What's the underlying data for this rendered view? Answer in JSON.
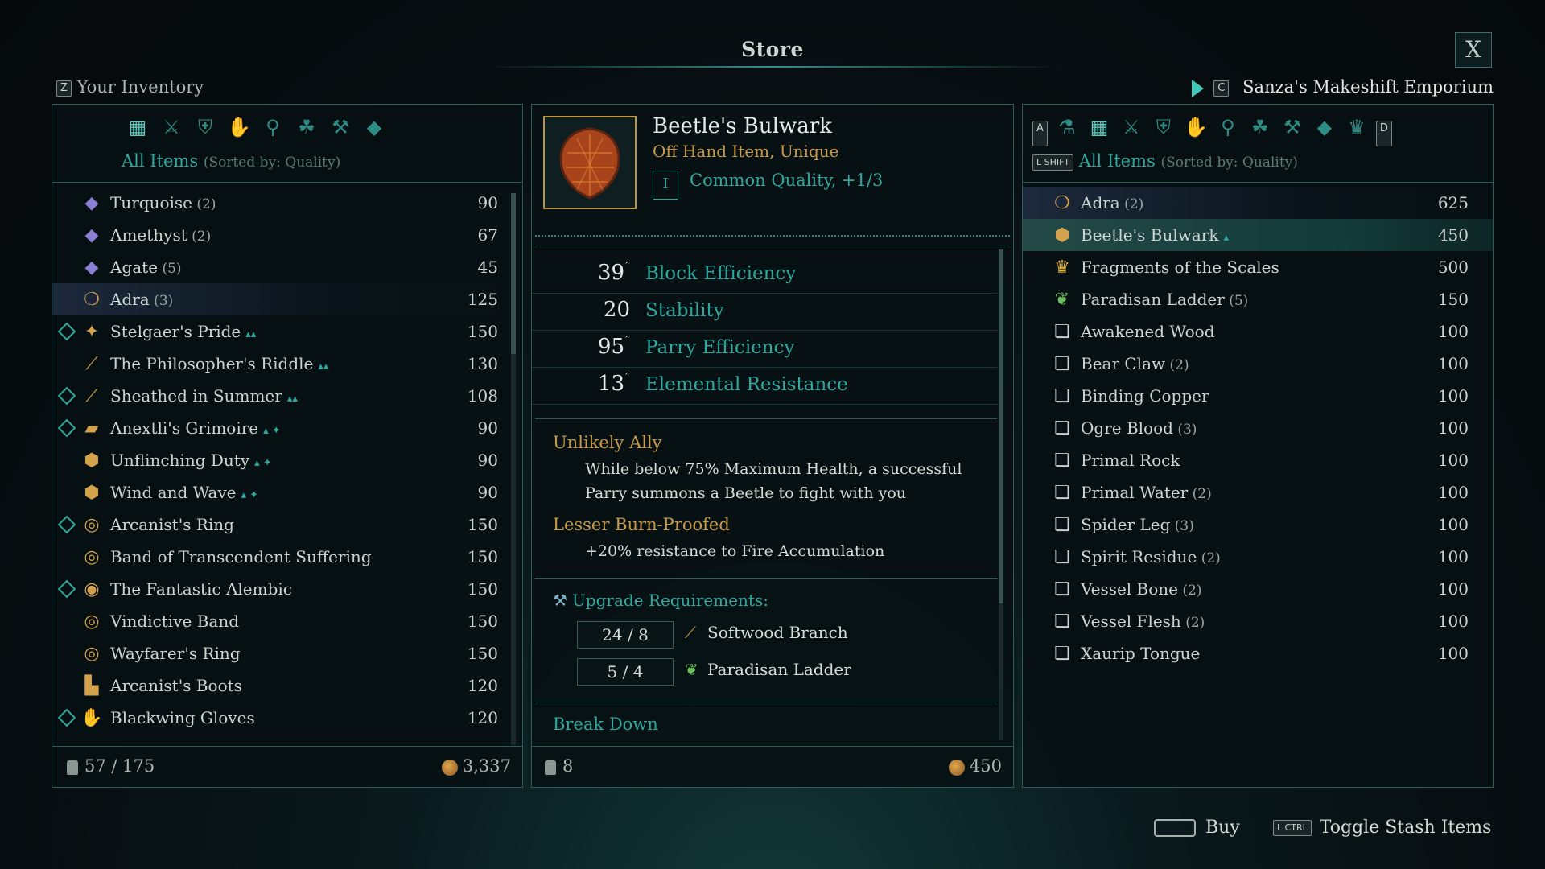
{
  "window": {
    "title": "Store",
    "close_label": "X"
  },
  "inventory": {
    "key": "Z",
    "title": "Your Inventory",
    "filter_label": "All Items",
    "sort_label": "(Sorted by: Quality)",
    "category_icons": [
      "all-items-icon",
      "weapons-icon",
      "armor-icon",
      "gloves-icon",
      "accessories-icon",
      "consumables-icon",
      "crafting-icon",
      "gems-icon"
    ],
    "items": [
      {
        "name": "Turquoise",
        "qty": "(2)",
        "price": "90",
        "icon": "gem-icon",
        "upgradeable": false,
        "tags": ""
      },
      {
        "name": "Amethyst",
        "qty": "(2)",
        "price": "67",
        "icon": "gem-icon",
        "upgradeable": false,
        "tags": ""
      },
      {
        "name": "Agate",
        "qty": "(5)",
        "price": "45",
        "icon": "gem-icon",
        "upgradeable": false,
        "tags": ""
      },
      {
        "name": "Adra",
        "qty": "(3)",
        "price": "125",
        "icon": "adra-icon",
        "upgradeable": false,
        "tags": "",
        "highlight": true
      },
      {
        "name": "Stelgaer's Pride",
        "qty": "",
        "price": "150",
        "icon": "armor-icon",
        "upgradeable": true,
        "tags": "▴▴"
      },
      {
        "name": "The Philosopher's Riddle",
        "qty": "",
        "price": "130",
        "icon": "sword-icon",
        "upgradeable": false,
        "tags": "▴▴"
      },
      {
        "name": "Sheathed in Summer",
        "qty": "",
        "price": "108",
        "icon": "dagger-icon",
        "upgradeable": true,
        "tags": "▴▴"
      },
      {
        "name": "Anextli's Grimoire",
        "qty": "",
        "price": "90",
        "icon": "grimoire-icon",
        "upgradeable": true,
        "tags": "▴ ✦"
      },
      {
        "name": "Unflinching Duty",
        "qty": "",
        "price": "90",
        "icon": "shield-icon",
        "upgradeable": false,
        "tags": "▴ ✦"
      },
      {
        "name": "Wind and Wave",
        "qty": "",
        "price": "90",
        "icon": "shield-icon",
        "upgradeable": false,
        "tags": "▴ ✦"
      },
      {
        "name": "Arcanist's Ring",
        "qty": "",
        "price": "150",
        "icon": "ring-icon",
        "upgradeable": true,
        "tags": ""
      },
      {
        "name": "Band of Transcendent Suffering",
        "qty": "",
        "price": "150",
        "icon": "ring-icon",
        "upgradeable": false,
        "tags": ""
      },
      {
        "name": "The Fantastic Alembic",
        "qty": "",
        "price": "150",
        "icon": "amulet-icon",
        "upgradeable": true,
        "tags": ""
      },
      {
        "name": "Vindictive Band",
        "qty": "",
        "price": "150",
        "icon": "ring-icon",
        "upgradeable": false,
        "tags": ""
      },
      {
        "name": "Wayfarer's Ring",
        "qty": "",
        "price": "150",
        "icon": "ring-icon",
        "upgradeable": false,
        "tags": ""
      },
      {
        "name": "Arcanist's Boots",
        "qty": "",
        "price": "120",
        "icon": "boots-icon",
        "upgradeable": false,
        "tags": ""
      },
      {
        "name": "Blackwing Gloves",
        "qty": "",
        "price": "120",
        "icon": "gloves-icon",
        "upgradeable": true,
        "tags": ""
      }
    ],
    "capacity": "57 / 175",
    "currency": "3,337"
  },
  "detail": {
    "name": "Beetle's Bulwark",
    "type": "Off Hand Item, Unique",
    "quality_tier": "I",
    "quality_text": "Common Quality, +1/3",
    "stats": [
      {
        "value": "39",
        "label": "Block Efficiency",
        "upgradeable": true
      },
      {
        "value": "20",
        "label": "Stability",
        "upgradeable": false
      },
      {
        "value": "95",
        "label": "Parry Efficiency",
        "upgradeable": true
      },
      {
        "value": "13",
        "label": "Elemental Resistance",
        "upgradeable": true
      }
    ],
    "traits": [
      {
        "title": "Unlikely Ally",
        "lines": [
          "While below 75% Maximum Health, a successful",
          "Parry summons a Beetle to fight with you"
        ]
      },
      {
        "title": "Lesser Burn-Proofed",
        "lines": [
          "+20% resistance to Fire Accumulation"
        ]
      }
    ],
    "upgrade_title": "Upgrade Requirements:",
    "requirements": [
      {
        "count": "24 / 8",
        "name": "Softwood Branch"
      },
      {
        "count": "5 / 4",
        "name": "Paradisan Ladder"
      }
    ],
    "break_down_title": "Break Down",
    "weight": "8",
    "price": "450"
  },
  "vendor": {
    "key": "C",
    "title": "Sanza's Makeshift Emporium",
    "tab_prev_key": "A",
    "tab_next_key": "D",
    "filter_key": "L SHIFT",
    "filter_label": "All Items",
    "sort_label": "(Sorted by: Quality)",
    "category_icons": [
      "potions-icon",
      "all-items-icon",
      "weapons-icon",
      "armor-icon",
      "gloves-icon",
      "accessories-icon",
      "consumables-icon",
      "crafting-icon",
      "gems-icon",
      "crown-icon"
    ],
    "items": [
      {
        "name": "Adra",
        "qty": "(2)",
        "price": "625",
        "icon": "adra-icon",
        "tags": "",
        "highlight": "dim"
      },
      {
        "name": "Beetle's Bulwark",
        "qty": "",
        "price": "450",
        "icon": "shield-icon",
        "tags": "▴",
        "highlight": "bright"
      },
      {
        "name": "Fragments of the Scales",
        "qty": "",
        "price": "500",
        "icon": "crown-icon",
        "tags": ""
      },
      {
        "name": "Paradisan Ladder",
        "qty": "(5)",
        "price": "150",
        "icon": "herb-icon",
        "tags": ""
      },
      {
        "name": "Awakened Wood",
        "qty": "",
        "price": "100",
        "icon": "scroll-icon",
        "tags": ""
      },
      {
        "name": "Bear Claw",
        "qty": "(2)",
        "price": "100",
        "icon": "scroll-icon",
        "tags": ""
      },
      {
        "name": "Binding Copper",
        "qty": "",
        "price": "100",
        "icon": "scroll-icon",
        "tags": ""
      },
      {
        "name": "Ogre Blood",
        "qty": "(3)",
        "price": "100",
        "icon": "scroll-icon",
        "tags": ""
      },
      {
        "name": "Primal Rock",
        "qty": "",
        "price": "100",
        "icon": "scroll-icon",
        "tags": ""
      },
      {
        "name": "Primal Water",
        "qty": "(2)",
        "price": "100",
        "icon": "scroll-icon",
        "tags": ""
      },
      {
        "name": "Spider Leg",
        "qty": "(3)",
        "price": "100",
        "icon": "scroll-icon",
        "tags": ""
      },
      {
        "name": "Spirit Residue",
        "qty": "(2)",
        "price": "100",
        "icon": "scroll-icon",
        "tags": ""
      },
      {
        "name": "Vessel Bone",
        "qty": "(2)",
        "price": "100",
        "icon": "scroll-icon",
        "tags": ""
      },
      {
        "name": "Vessel Flesh",
        "qty": "(2)",
        "price": "100",
        "icon": "scroll-icon",
        "tags": ""
      },
      {
        "name": "Xaurip Tongue",
        "qty": "",
        "price": "100",
        "icon": "scroll-icon",
        "tags": ""
      }
    ]
  },
  "actions": {
    "buy_label": "Buy",
    "toggle_key": "L CTRL",
    "toggle_label": "Toggle Stash Items"
  },
  "colors": {
    "accent": "#2fa89e",
    "gold": "#c79a4a",
    "border": "#2b5c5a"
  }
}
